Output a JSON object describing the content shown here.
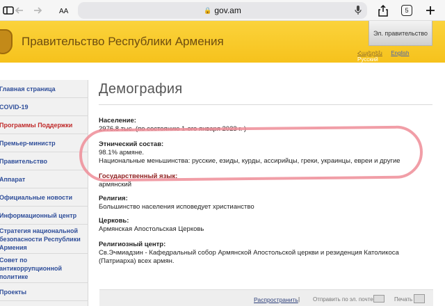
{
  "browser": {
    "url": "gov.am",
    "tab_count": "5"
  },
  "header": {
    "site_title": "Правительство Республики Армения",
    "egov_label": "Эл. правительство",
    "languages": [
      "Հայերեն",
      "English",
      "Русский"
    ]
  },
  "sidebar": {
    "items": [
      {
        "label": "Главная страница"
      },
      {
        "label": "COVID-19"
      },
      {
        "label": "Программы Поддержки"
      },
      {
        "label": "Премьер-министр"
      },
      {
        "label": "Правительство"
      },
      {
        "label": "Аппарат"
      },
      {
        "label": "Официальные новости"
      },
      {
        "label": "Информационный центр"
      },
      {
        "label": "Стратегия национальной безопасности Республики Армения"
      },
      {
        "label": "Совет по антикоррупционной политике"
      },
      {
        "label": "Проекты"
      }
    ]
  },
  "main": {
    "title": "Демография",
    "population_label": "Население:",
    "population_value": "2976.8 тыс. (по состоянию 1-ого января 2023 г. )",
    "ethnic_label": "Этнический состав:",
    "ethnic_value1": "98.1% армяне.",
    "ethnic_value2": "Национальные меньшинства: русские, езиды, курды, ассирийцы, греки, украинцы, евреи и другие",
    "language_label": "Государственный язык:",
    "language_value": "армянский",
    "religion_label": "Религия:",
    "religion_value": "Большинство населения исповедует христианство",
    "church_label": "Церковь:",
    "church_value": "Армянская Апостольская Церковь",
    "center_label": "Религиозный центр:",
    "center_value1": "Св.Эчмиадзин - Кафедральный собор Армянской Апостольской церкви и резиденция Католикоса",
    "center_value2": "(Патриарха) всех армян."
  },
  "bottom_bar": {
    "share_label": "Распространить",
    "separator": "|",
    "mail_label": "Отправить по эл. почте",
    "print_label": "Печать"
  },
  "colors": {
    "header_yellow": "#f6c21c",
    "sidebar_link": "#2f4e9a",
    "sidebar_active": "#c02b2b",
    "highlight": "#ef8d98"
  }
}
